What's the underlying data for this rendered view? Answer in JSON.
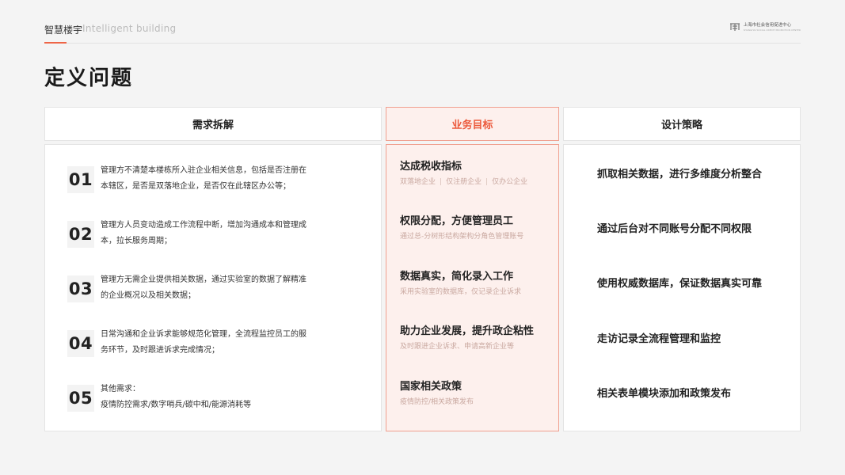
{
  "header": {
    "title": "智慧楼宇",
    "subtitle": "Intelligent  building",
    "logo_text": "上海市社会信用促进中心",
    "logo_subtext": "SHANGHAI SOCIAL CREDIT PROMOTION CENTER"
  },
  "page_title": "定义问题",
  "columns": {
    "needs": "需求拆解",
    "goals": "业务目标",
    "strategy": "设计策略"
  },
  "accent_color": "#ee6547",
  "needs": [
    {
      "num": "01",
      "line1": "管理方不清楚本楼栋所入驻企业相关信息，包括是否注册在",
      "line2": "本辖区，是否是双落地企业，是否仅在此辖区办公等；"
    },
    {
      "num": "02",
      "line1": "管理方人员变动造成工作流程中断，增加沟通成本和管理成",
      "line2": "本，拉长服务周期；"
    },
    {
      "num": "03",
      "line1": "管理方无需企业提供相关数据，通过实验室的数据了解精准",
      "line2": "的企业概况以及相关数据；"
    },
    {
      "num": "04",
      "line1": "日常沟通和企业诉求能够规范化管理，全流程监控员工的服",
      "line2": "务环节，及时跟进诉求完成情况；"
    },
    {
      "num": "05",
      "line1": "其他需求：",
      "line2": "疫情防控需求/数字哨兵/碳中和/能源消耗等"
    }
  ],
  "goals": [
    {
      "title": "达成税收指标",
      "sub_parts": [
        "双落地企业",
        "仅注册企业",
        "仅办公企业"
      ]
    },
    {
      "title": "权限分配，方便管理员工",
      "sub": "通过总-分树形结构架构分角色管理账号"
    },
    {
      "title": "数据真实，简化录入工作",
      "sub": "采用实验室的数据库，仅记录企业诉求"
    },
    {
      "title": "助力企业发展，提升政企粘性",
      "sub": "及时跟进企业诉求、申请高新企业等"
    },
    {
      "title": "国家相关政策",
      "sub": "疫情防控/相关政策发布"
    }
  ],
  "separator": "|",
  "strategies": [
    "抓取相关数据，进行多维度分析整合",
    "通过后台对不同账号分配不同权限",
    "使用权威数据库，保证数据真实可靠",
    "走访记录全流程管理和监控",
    "相关表单模块添加和政策发布"
  ]
}
